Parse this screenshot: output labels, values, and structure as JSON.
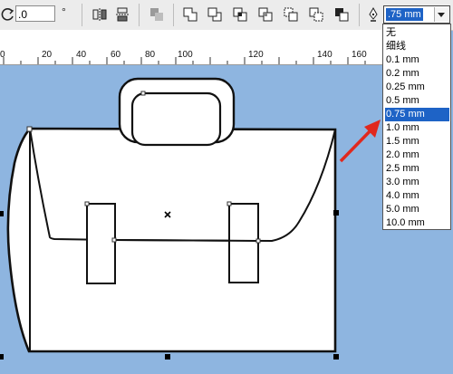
{
  "toolbar": {
    "rotation_value": ".0",
    "degree_symbol": "°"
  },
  "outline_width": {
    "current_value": ".75 mm",
    "options": [
      "无",
      "细线",
      "0.1 mm",
      "0.2 mm",
      "0.25 mm",
      "0.5 mm",
      "0.75 mm",
      "1.0 mm",
      "1.5 mm",
      "2.0 mm",
      "2.5 mm",
      "3.0 mm",
      "4.0 mm",
      "5.0 mm",
      "10.0 mm"
    ],
    "selected_index": 6
  },
  "ruler": {
    "labels": [
      "0",
      "20",
      "40",
      "60",
      "80",
      "100",
      "120",
      "140",
      "160"
    ]
  },
  "colors": {
    "canvas_bg": "#8eb5e0",
    "selection_highlight": "#1e63c6",
    "arrow": "#e0281e"
  }
}
